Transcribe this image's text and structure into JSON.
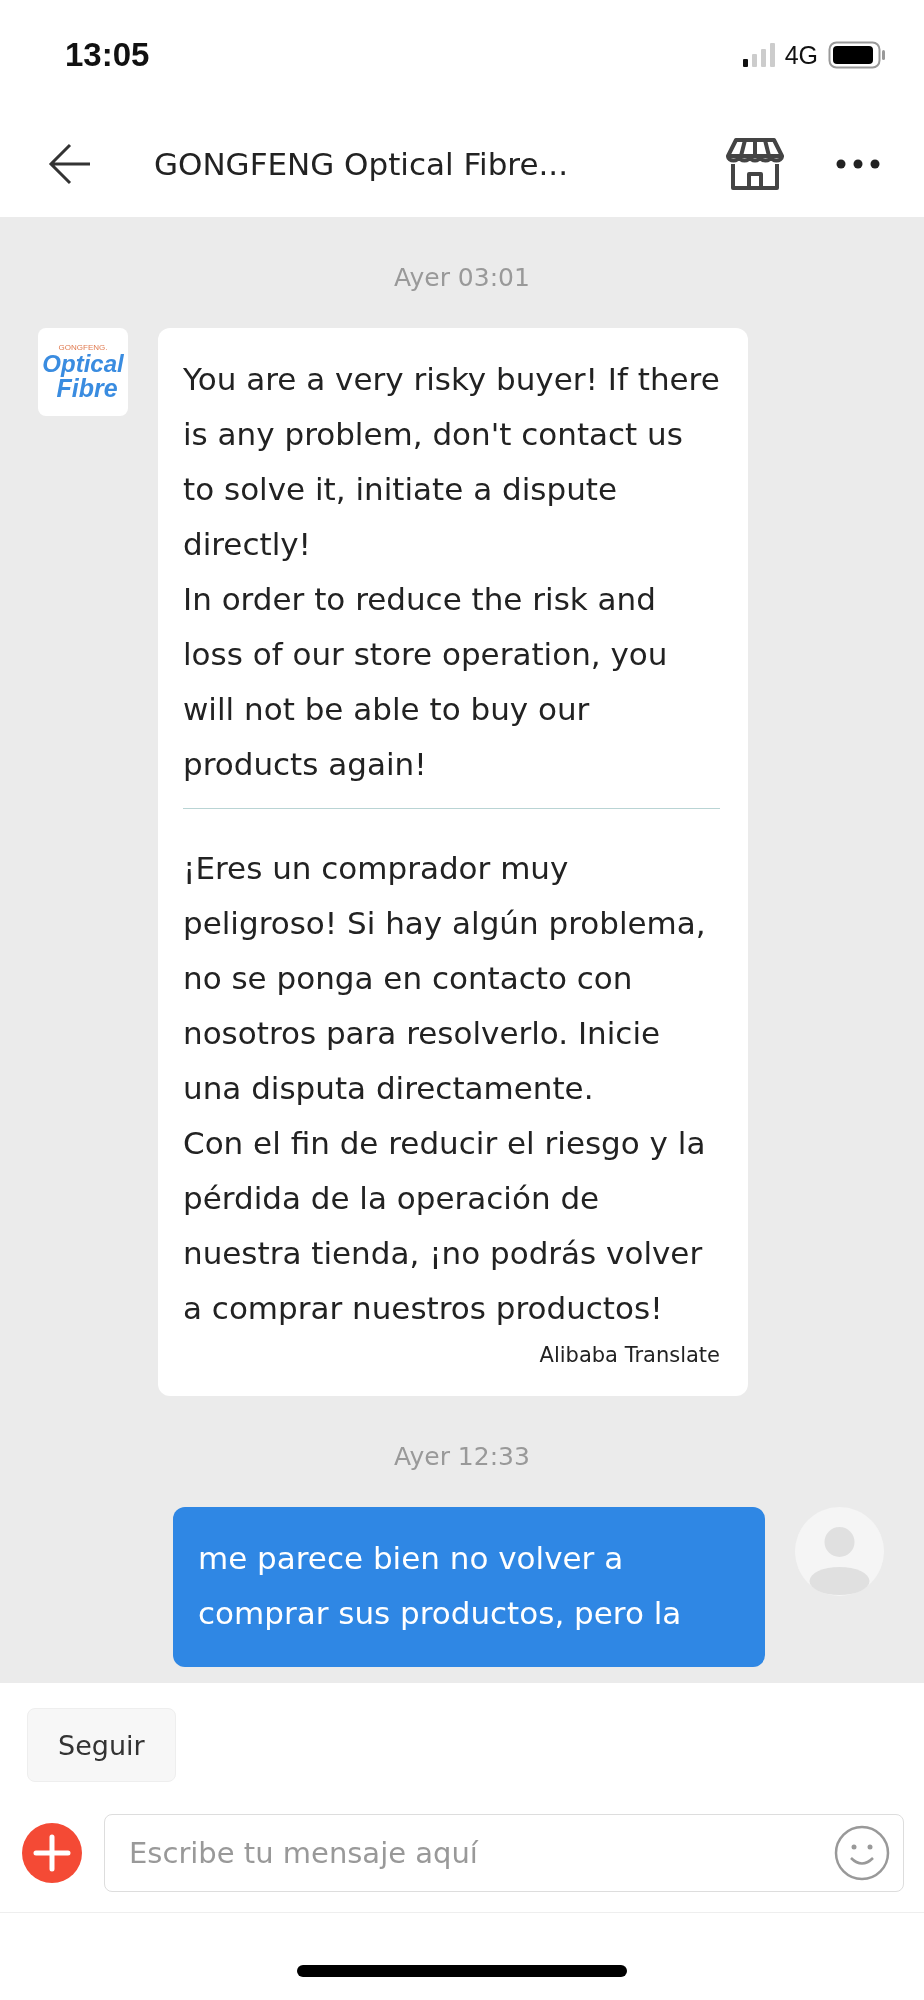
{
  "status_bar": {
    "time": "13:05",
    "network": "4G"
  },
  "header": {
    "title": "GONGFENG Optical Fibre..."
  },
  "messages": [
    {
      "kind": "timestamp",
      "text": "Ayer 03:01"
    },
    {
      "kind": "incoming",
      "avatar": {
        "brand": "GONGFENG.",
        "line_1": "Optical",
        "line_2": "Fibre"
      },
      "original": [
        "You are a very risky buyer! If there is any problem, don't contact us to solve it, initiate a dispute directly!",
        "In order to reduce the risk and loss of our store operation, you will not be able to buy our products again!"
      ],
      "translation": [
        "¡Eres un comprador muy peligroso! Si hay algún problema, no se ponga en contacto con nosotros para resolverlo. Inicie una disputa directamente.",
        "Con el fin de reducir el riesgo y la pérdida de la operación de nuestra tienda, ¡no podrás volver a comprar nuestros productos!"
      ],
      "credit": "Alibaba Translate"
    },
    {
      "kind": "timestamp",
      "text": "Ayer 12:33"
    },
    {
      "kind": "outgoing",
      "text": "me parece bien no volver a comprar sus productos, pero la"
    }
  ],
  "quick_replies": [
    "Seguir"
  ],
  "composer": {
    "placeholder": "Escribe tu mensaje aquí"
  }
}
